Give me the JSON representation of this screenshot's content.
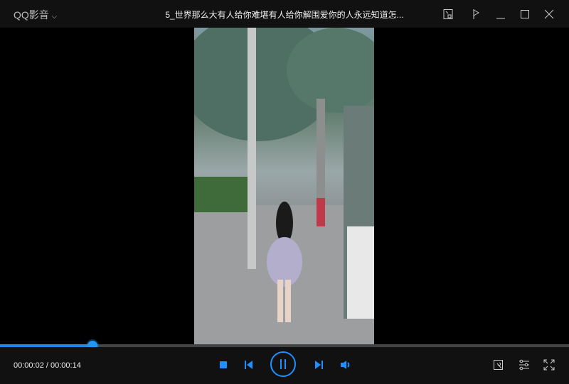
{
  "app": {
    "name": "QQ影音",
    "title": "5_世界那么大有人给你难堪有人给你解围爱你的人永远知道怎..."
  },
  "player": {
    "current_time": "00:00:02",
    "total_time": "00:00:14",
    "time_display": "00:00:02 / 00:00:14",
    "progress_fraction": 0.163
  },
  "colors": {
    "accent": "#1e90ff",
    "bg": "#111111"
  }
}
